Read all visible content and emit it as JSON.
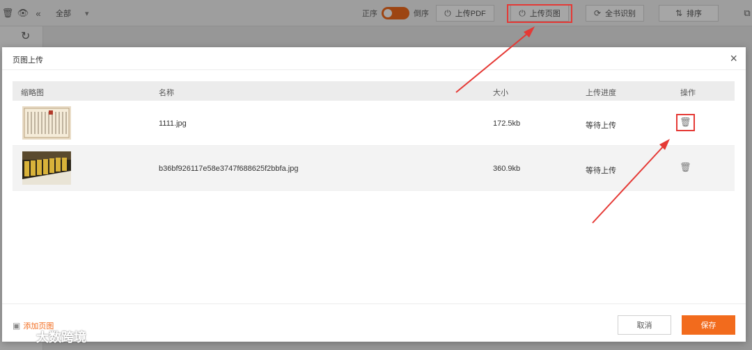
{
  "toolbar": {
    "filter_label": "全部",
    "sort_order_label": "正序",
    "sort_reverse_label": "倒序",
    "buttons": [
      {
        "label": "上传PDF",
        "icon": "upload-icon"
      },
      {
        "label": "上传页图",
        "icon": "upload-icon"
      },
      {
        "label": "全书识别",
        "icon": "refresh-icon"
      },
      {
        "label": "排序",
        "icon": "sort-icon"
      }
    ]
  },
  "dialog": {
    "title": "页图上传",
    "columns": [
      "缩略图",
      "名称",
      "大小",
      "上传进度",
      "操作"
    ],
    "rows": [
      {
        "name": "1111.jpg",
        "size": "172.5kb",
        "progress": "等待上传"
      },
      {
        "name": "b36bf926117e58e3747f688625f2bbfa.jpg",
        "size": "360.9kb",
        "progress": "等待上传"
      }
    ],
    "add_page_label": "添加页图",
    "cancel_label": "取消",
    "save_label": "保存"
  },
  "watermark": "大数跨境",
  "colors": {
    "accent": "#f26b1d",
    "annotation": "#e53935"
  }
}
